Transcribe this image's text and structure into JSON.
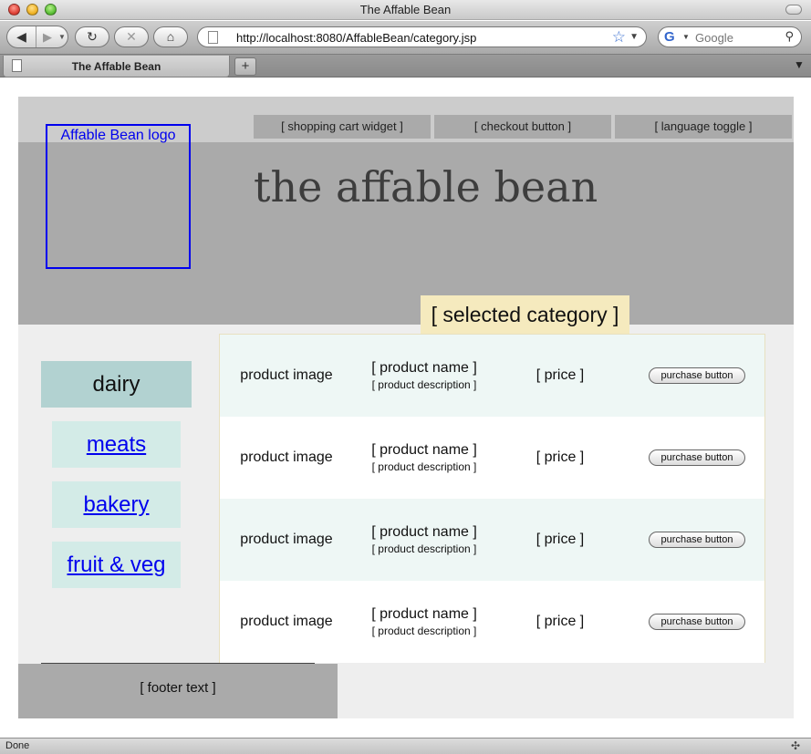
{
  "browser": {
    "window_title": "The Affable Bean",
    "url": "http://localhost:8080/AffableBean/category.jsp",
    "search_placeholder": "Google",
    "tab_label": "The Affable Bean",
    "new_tab_label": "+",
    "status": "Done"
  },
  "header": {
    "logo_text": "Affable Bean logo",
    "cart_widget": "[ shopping cart widget ]",
    "checkout_button": "[ checkout button ]",
    "language_toggle": "[ language toggle ]",
    "site_title": "the affable bean",
    "selected_category": "[ selected category ]"
  },
  "categories": {
    "selected": "dairy",
    "links": [
      "meats",
      "bakery",
      "fruit & veg"
    ]
  },
  "products": [
    {
      "image": "product image",
      "name": "[ product name ]",
      "description": "[ product description ]",
      "price": "[ price ]",
      "button": "purchase button"
    },
    {
      "image": "product image",
      "name": "[ product name ]",
      "description": "[ product description ]",
      "price": "[ price ]",
      "button": "purchase button"
    },
    {
      "image": "product image",
      "name": "[ product name ]",
      "description": "[ product description ]",
      "price": "[ price ]",
      "button": "purchase button"
    },
    {
      "image": "product image",
      "name": "[ product name ]",
      "description": "[ product description ]",
      "price": "[ price ]",
      "button": "purchase button"
    }
  ],
  "footer": {
    "text": "[ footer text ]"
  },
  "colors": {
    "header_top": "#cccccc",
    "header": "#aaaaaa",
    "selected_category_bg": "#f5eabe",
    "selected_cat_menu": "#b2d2d1",
    "cat_menu": "#d3ebe7",
    "odd_row": "#eef7f5",
    "link": "#0000ee"
  }
}
